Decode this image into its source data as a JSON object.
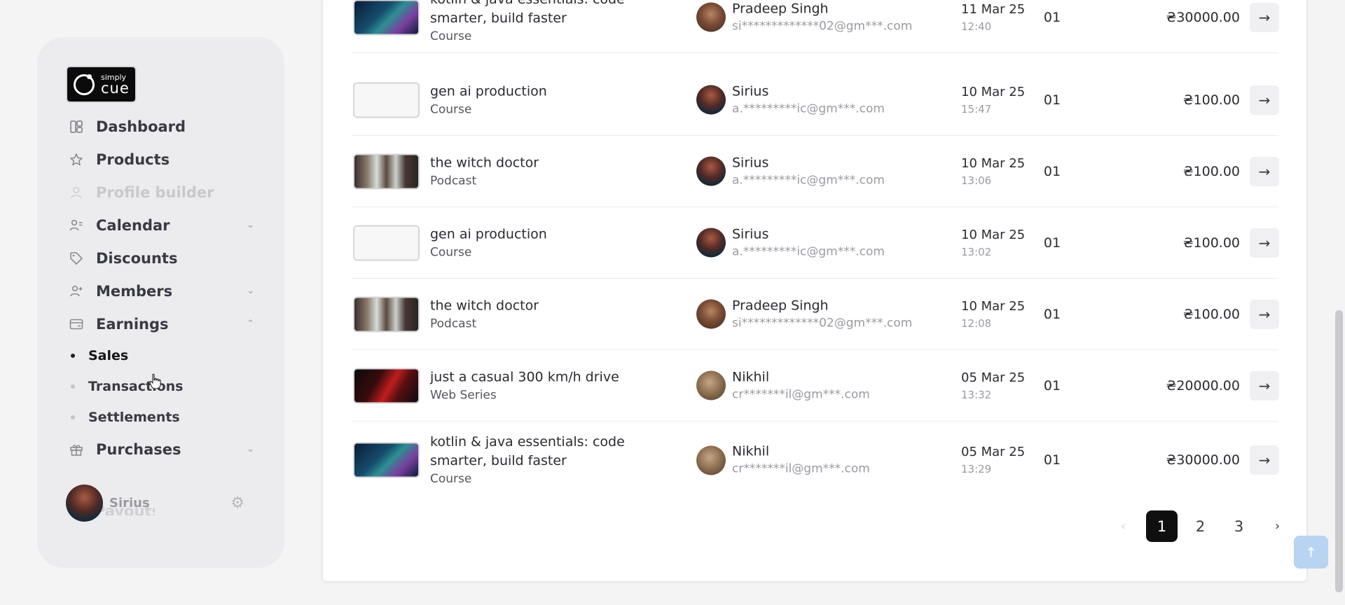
{
  "sidebar": {
    "logo": {
      "line1": "simply",
      "line2": "cue"
    },
    "nav": [
      {
        "label": "Dashboard",
        "icon": "dashboard-icon"
      },
      {
        "label": "Products",
        "icon": "star-icon"
      },
      {
        "label": "Profile builder",
        "icon": "person-icon",
        "disabled": true
      },
      {
        "label": "Calendar",
        "icon": "calendar-person-icon",
        "expandable": true
      },
      {
        "label": "Discounts",
        "icon": "tag-icon"
      },
      {
        "label": "Members",
        "icon": "members-icon",
        "expandable": true
      },
      {
        "label": "Earnings",
        "icon": "card-icon",
        "expanded": true
      }
    ],
    "earnings_sub": [
      {
        "label": "Sales",
        "active": true
      },
      {
        "label": "Transactions"
      },
      {
        "label": "Settlements"
      }
    ],
    "purchases": {
      "label": "Purchases",
      "icon": "gift-icon"
    },
    "faded_label": "Payouts",
    "user": {
      "name": "Sirius"
    }
  },
  "rows": [
    {
      "title": "kotlin & java essentials: code smarter, build faster",
      "type": "Course",
      "thumb": "code",
      "buyer": "Pradeep Singh",
      "email": "si*************02@gm***.com",
      "avatar": "pradeep",
      "date": "11 Mar 25",
      "time": "12:40",
      "qty": "01",
      "amount": "₴30000.00"
    },
    {
      "title": "gen ai production",
      "type": "Course",
      "thumb": "blank",
      "buyer": "Sirius",
      "email": "a.*********ic@gm***.com",
      "avatar": "sirius",
      "date": "10 Mar 25",
      "time": "15:47",
      "qty": "01",
      "amount": "₴100.00"
    },
    {
      "title": "the witch doctor",
      "type": "Podcast",
      "thumb": "witch",
      "buyer": "Sirius",
      "email": "a.*********ic@gm***.com",
      "avatar": "sirius",
      "date": "10 Mar 25",
      "time": "13:06",
      "qty": "01",
      "amount": "₴100.00"
    },
    {
      "title": "gen ai production",
      "type": "Course",
      "thumb": "blank",
      "buyer": "Sirius",
      "email": "a.*********ic@gm***.com",
      "avatar": "sirius",
      "date": "10 Mar 25",
      "time": "13:02",
      "qty": "01",
      "amount": "₴100.00"
    },
    {
      "title": "the witch doctor",
      "type": "Podcast",
      "thumb": "witch",
      "buyer": "Pradeep Singh",
      "email": "si*************02@gm***.com",
      "avatar": "pradeep",
      "date": "10 Mar 25",
      "time": "12:08",
      "qty": "01",
      "amount": "₴100.00"
    },
    {
      "title": "just a casual 300 km/h drive",
      "type": "Web Series",
      "thumb": "car",
      "buyer": "Nikhil",
      "email": "cr*******il@gm***.com",
      "avatar": "nikhil",
      "date": "05 Mar 25",
      "time": "13:32",
      "qty": "01",
      "amount": "₴20000.00"
    },
    {
      "title": "kotlin & java essentials: code smarter, build faster",
      "type": "Course",
      "thumb": "code",
      "buyer": "Nikhil",
      "email": "cr*******il@gm***.com",
      "avatar": "nikhil",
      "date": "05 Mar 25",
      "time": "13:29",
      "qty": "01",
      "amount": "₴30000.00"
    }
  ],
  "pagination": {
    "pages": [
      "1",
      "2",
      "3"
    ],
    "current": "1",
    "prev_icon": "chevron-left-icon",
    "next_icon": "chevron-right-icon"
  },
  "colors": {
    "accent": "#0f0f10",
    "scroll_top_button": "#b9d3f3",
    "sidebar_bg": "#ececee"
  }
}
